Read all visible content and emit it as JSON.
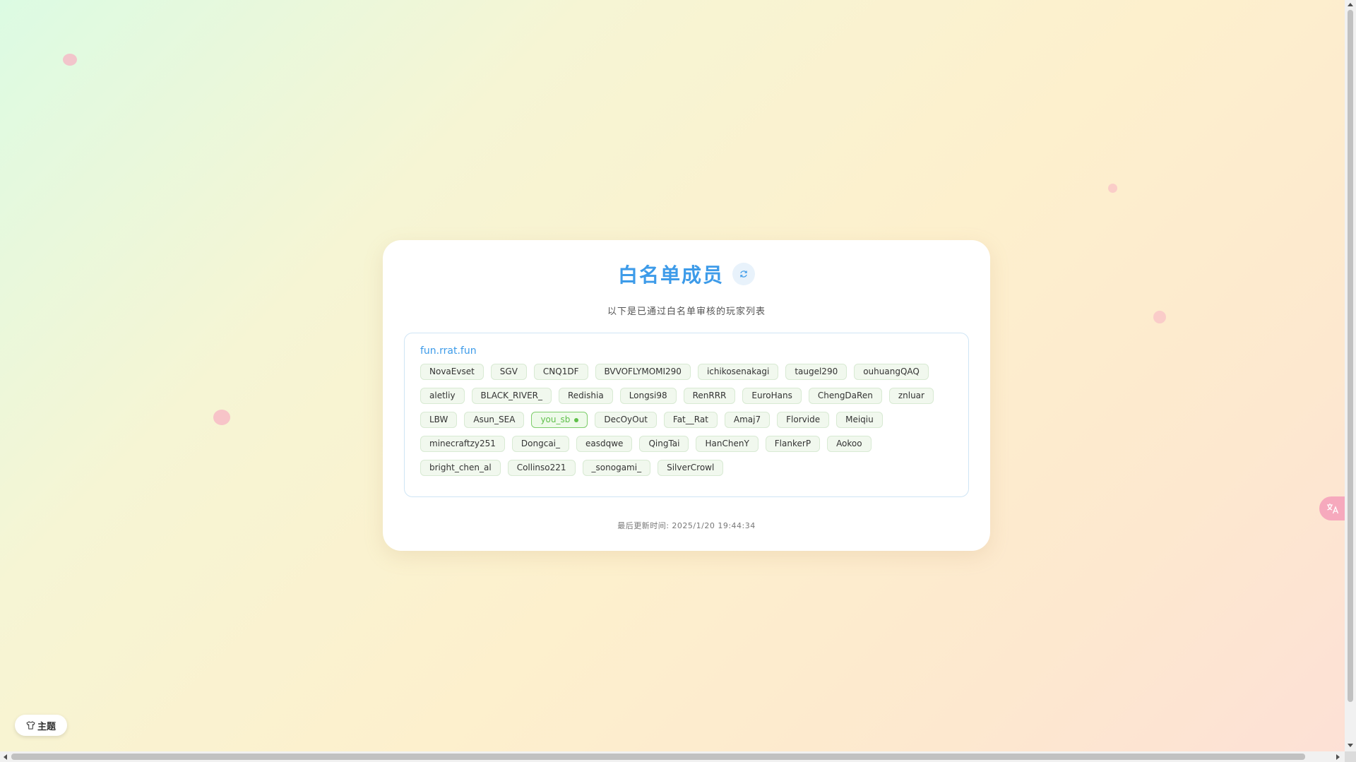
{
  "header": {
    "title": "白名单成员",
    "refresh_icon": "refresh-icon",
    "subtitle": "以下是已通过白名单审核的玩家列表"
  },
  "server": {
    "name": "fun.rrat.fun",
    "players": [
      "NovaEvset",
      "SGV",
      "CNQ1DF",
      "BVVOFLYMOMI290",
      "ichikosenakagi",
      "taugel290",
      "ouhuangQAQ",
      "aletliy",
      "BLACK_RIVER_",
      "Redishia",
      "Longsi98",
      "RenRRR",
      "EuroHans",
      "ChengDaRen",
      "znluar",
      "LBW",
      "Asun_SEA",
      "you_sb",
      "DecOyOut",
      "Fat__Rat",
      "Amaj7",
      "Florvide",
      "Meiqiu",
      "minecraftzy251",
      "Dongcai_",
      "easdqwe",
      "QingTai",
      "HanChenY",
      "FlankerP",
      "Aokoo",
      "bright_chen_al",
      "Collinso221",
      "_sonogami_",
      "SilverCrowl"
    ],
    "current_player": "you_sb"
  },
  "footer": {
    "last_updated": "最后更新时间: 2025/1/20 19:44:34"
  },
  "theme_button": {
    "label": "主题",
    "icon": "shirt-icon"
  },
  "translate_button": {
    "icon": "translate-icon"
  },
  "colors": {
    "accent": "#3d9be9",
    "tag_bg": "#f1f8ee",
    "current_tag": "#5fbf4a",
    "translate_bg": "#f6a9bd"
  }
}
